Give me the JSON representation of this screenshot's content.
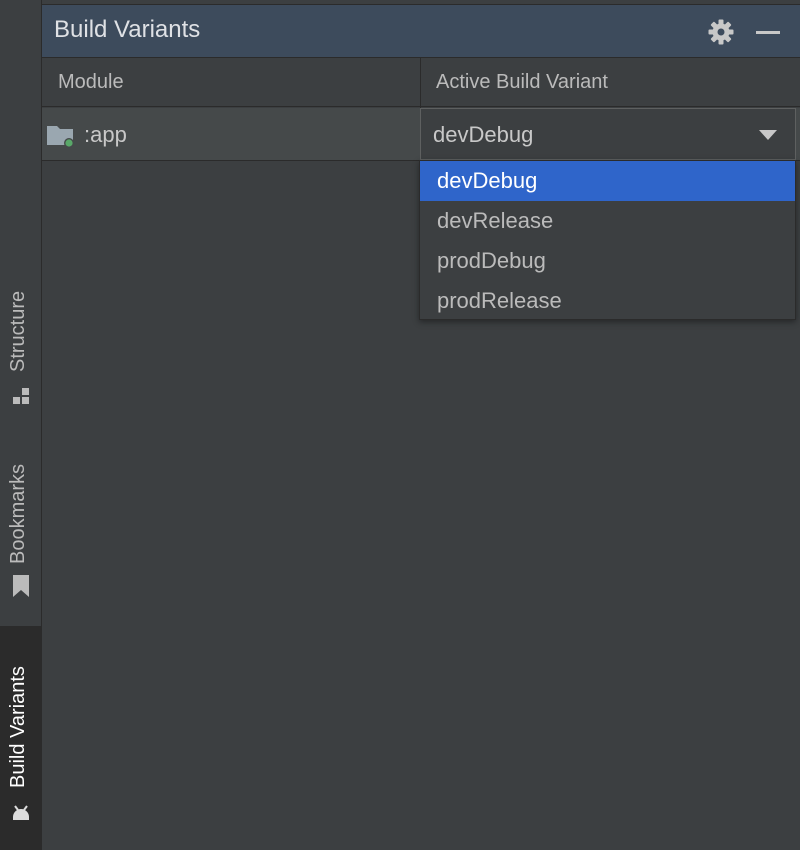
{
  "side_strip": {
    "tabs": [
      {
        "label": "Structure",
        "icon": "structure-icon",
        "active": false
      },
      {
        "label": "Bookmarks",
        "icon": "bookmark-icon",
        "active": false
      },
      {
        "label": "Build Variants",
        "icon": "android-icon",
        "active": true
      }
    ]
  },
  "panel": {
    "title": "Build Variants",
    "settings_icon": "gear-icon",
    "minimize_icon": "minimize-icon"
  },
  "table": {
    "columns": [
      "Module",
      "Active Build Variant"
    ],
    "rows": [
      {
        "module": ":app",
        "variant": "devDebug",
        "module_icon": "module-folder-icon"
      }
    ]
  },
  "dropdown": {
    "options": [
      "devDebug",
      "devRelease",
      "prodDebug",
      "prodRelease"
    ],
    "selected": "devDebug"
  },
  "colors": {
    "header_bg": "#3d4b5c",
    "panel_bg": "#3c3f41",
    "selection": "#2f65ca",
    "row_bg": "#45494a",
    "module_status_dot": "#59a869"
  }
}
